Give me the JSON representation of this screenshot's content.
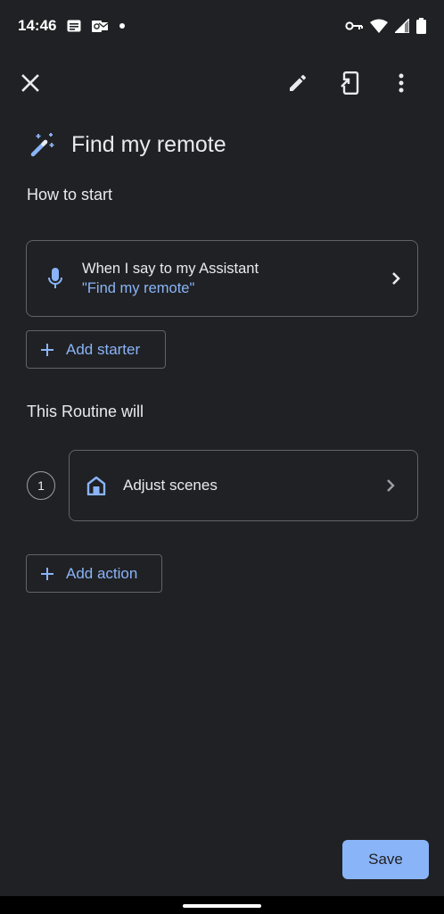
{
  "status_bar": {
    "time": "14:46",
    "notification_icons": [
      "news-icon",
      "outlook-icon",
      "dot-icon"
    ],
    "system_icons": [
      "vpn-key-icon",
      "wifi-icon",
      "signal-icon",
      "battery-icon"
    ]
  },
  "toolbar": {
    "close_icon": "close-icon",
    "edit_icon": "pencil-icon",
    "cast_icon": "phone-cast-icon",
    "more_icon": "more-vert-icon"
  },
  "routine": {
    "title": "Find my remote",
    "title_icon": "magic-wand-icon"
  },
  "starter_section": {
    "label": "How to start",
    "starter": {
      "title": "When I say to my Assistant",
      "phrase": "\"Find my remote\"",
      "icon": "microphone-icon"
    },
    "add_button_label": "Add starter"
  },
  "actions_section": {
    "label": "This Routine will",
    "actions": [
      {
        "number": "1",
        "label": "Adjust scenes",
        "icon": "home-icon"
      }
    ],
    "add_button_label": "Add action"
  },
  "footer": {
    "save_label": "Save"
  },
  "colors": {
    "background": "#202124",
    "accent": "#8ab4f8",
    "text": "#e8eaed",
    "border": "#5f6368"
  }
}
